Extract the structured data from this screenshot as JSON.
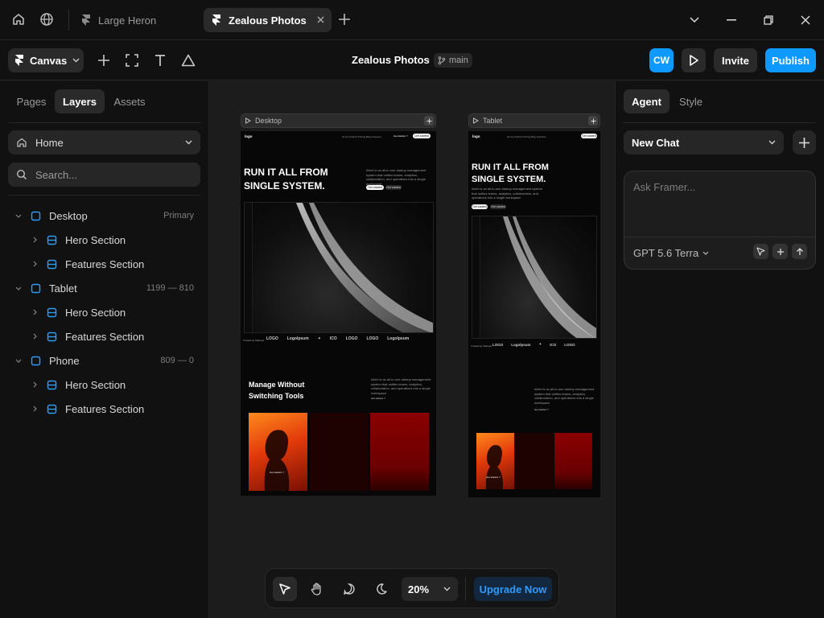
{
  "titlebar": {
    "home_icon": "home-icon",
    "globe_icon": "globe-icon",
    "tabs": [
      {
        "label": "Large Heron",
        "active": false
      },
      {
        "label": "Zealous Photos",
        "active": true
      }
    ],
    "new_tab_icon": "plus-icon"
  },
  "toolbar": {
    "canvas_label": "Canvas",
    "project_title": "Zealous Photos",
    "separator": "·",
    "branch": "main",
    "avatar_initials": "CW",
    "invite_label": "Invite",
    "publish_label": "Publish"
  },
  "left_panel": {
    "tabs": [
      "Pages",
      "Layers",
      "Assets"
    ],
    "active_tab": "Layers",
    "page_select": "Home",
    "search_placeholder": "Search...",
    "layers": [
      {
        "label": "Desktop",
        "meta": "Primary",
        "level": 0
      },
      {
        "label": "Hero Section",
        "meta": "",
        "level": 1
      },
      {
        "label": "Features Section",
        "meta": "",
        "level": 1
      },
      {
        "label": "Tablet",
        "meta": "1199 — 810",
        "level": 0
      },
      {
        "label": "Hero Section",
        "meta": "",
        "level": 1
      },
      {
        "label": "Features Section",
        "meta": "",
        "level": 1
      },
      {
        "label": "Phone",
        "meta": "809 — 0",
        "level": 0
      },
      {
        "label": "Hero Section",
        "meta": "",
        "level": 1
      },
      {
        "label": "Features Section",
        "meta": "",
        "level": 1
      }
    ]
  },
  "canvas": {
    "desktop": {
      "label": "Desktop",
      "logo": "logo",
      "nav": "Home  Product  Pricing  Blog  Features",
      "nav_cta": "Get started ↗",
      "nav_cta2": "Get started",
      "hero_title_1": "RUN IT ALL FROM",
      "hero_title_2": "SINGLE SYSTEM.",
      "hero_desc": "Abrhi is an all-in-one startup management system that unifies teams, analytics, collaboration, and operations into a single workspace",
      "btn_primary": "Get started",
      "btn_secondary": "Get started",
      "trusted": "Trusted by Startups",
      "logos": [
        "LOGO",
        "Logolpsum",
        "✦",
        "ICO",
        "LOGO",
        "LOGO",
        "Logolpsum"
      ],
      "features_title_1": "Manage Without",
      "features_title_2": "Switching Tools",
      "features_desc": "Abrhi is an all-in-one startup management system that unifies teams, analytics, collaboration, and operations into a single workspace",
      "features_link": "Get started ↗",
      "card_cta": "Get started ↗"
    },
    "tablet": {
      "label": "Tablet",
      "hero_title_1": "RUN IT ALL FROM",
      "hero_title_2": "SINGLE SYSTEM."
    }
  },
  "bottom_bar": {
    "zoom": "20%",
    "upgrade_label": "Upgrade Now"
  },
  "right_panel": {
    "tabs": [
      "Agent",
      "Style"
    ],
    "active_tab": "Agent",
    "chat_select": "New Chat",
    "chat_placeholder": "Ask Framer...",
    "model": "GPT 5.6 Terra"
  },
  "colors": {
    "accent": "#0e99ff",
    "background": "#111111",
    "canvas": "#1c1c1c",
    "frame_icon": "#2e9bff"
  }
}
